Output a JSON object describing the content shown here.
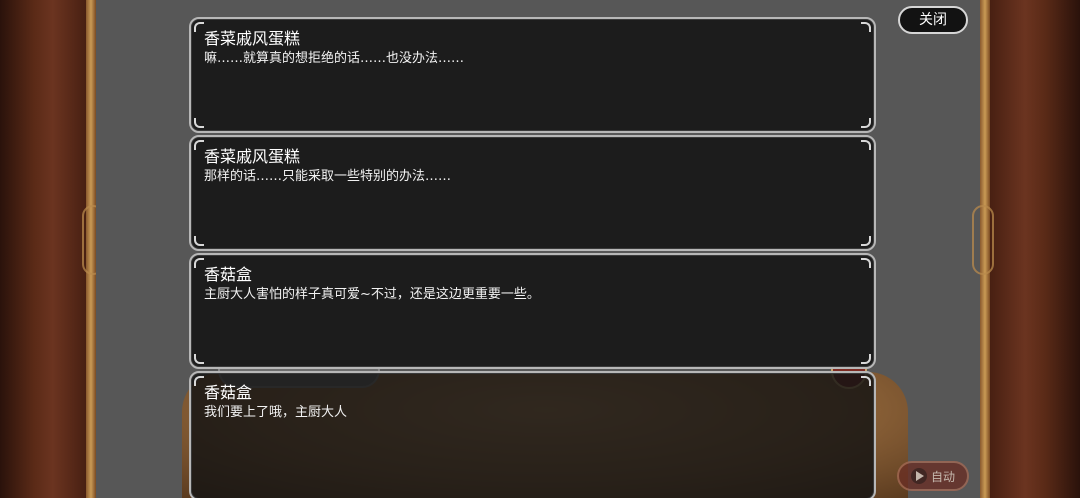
{
  "close_label": "关闭",
  "auto_label": "自动",
  "log": [
    {
      "speaker": "香菜戚风蛋糕",
      "text": "嘛……就算真的想拒绝的话……也没办法……"
    },
    {
      "speaker": "香菜戚风蛋糕",
      "text": "那样的话……只能采取一些特别的办法……"
    },
    {
      "speaker": "香菇盒",
      "text": "主厨大人害怕的样子真可爱~不过，还是这边更重要一些。"
    },
    {
      "speaker": "香菇盒",
      "text": "我们要上了哦，主厨大人"
    }
  ],
  "colors": {
    "panel": "#1c1c1c",
    "border": "#b7b7b7",
    "frame": "#5a2a17",
    "stage": "#575757"
  },
  "icons": {
    "auto": "play-icon"
  }
}
